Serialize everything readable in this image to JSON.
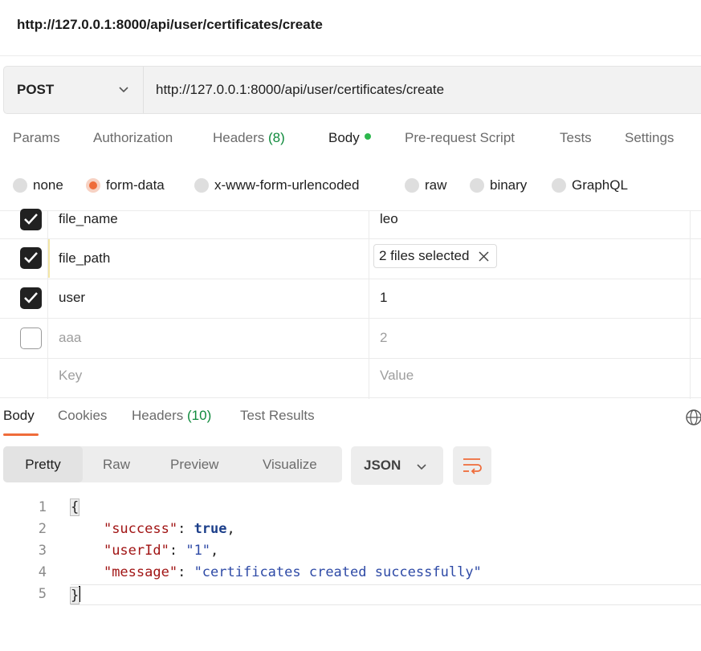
{
  "window": {
    "title": "http://127.0.0.1:8000/api/user/certificates/create"
  },
  "request": {
    "method": "POST",
    "url": "http://127.0.0.1:8000/api/user/certificates/create"
  },
  "request_tabs": [
    {
      "label": "Params"
    },
    {
      "label": "Authorization"
    },
    {
      "label": "Headers",
      "count": "(8)"
    },
    {
      "label": "Body",
      "active": true
    },
    {
      "label": "Pre-request Script"
    },
    {
      "label": "Tests"
    },
    {
      "label": "Settings"
    }
  ],
  "body_types": [
    "none",
    "form-data",
    "x-www-form-urlencoded",
    "raw",
    "binary",
    "GraphQL"
  ],
  "body_type_selected": "form-data",
  "form_data": [
    {
      "key": "file_name",
      "value": "leo",
      "checked": true
    },
    {
      "key": "file_path",
      "value": "2 files selected",
      "checked": true,
      "type": "file"
    },
    {
      "key": "user",
      "value": "1",
      "checked": true
    },
    {
      "key": "aaa",
      "value": "2",
      "checked": false
    }
  ],
  "form_placeholder": {
    "key": "Key",
    "value": "Value"
  },
  "response_tabs": [
    {
      "label": "Body",
      "active": true
    },
    {
      "label": "Cookies"
    },
    {
      "label": "Headers",
      "count": "(10)"
    },
    {
      "label": "Test Results"
    }
  ],
  "view_modes": [
    "Pretty",
    "Raw",
    "Preview",
    "Visualize"
  ],
  "view_mode_selected": "Pretty",
  "format": "JSON",
  "response_lines": [
    {
      "n": "1",
      "open": "{"
    },
    {
      "n": "2",
      "key": "\"success\"",
      "value": "true",
      "kind": "bool",
      "comma": ","
    },
    {
      "n": "3",
      "key": "\"userId\"",
      "value": "\"1\"",
      "kind": "str",
      "comma": ","
    },
    {
      "n": "4",
      "key": "\"message\"",
      "value": "\"certificates created successfully\"",
      "kind": "str",
      "comma": ""
    },
    {
      "n": "5",
      "close": "}"
    }
  ],
  "colors": {
    "accent": "#ef6c3a",
    "dot": "#2db84d",
    "count": "#0f8a3c"
  },
  "icons": {
    "method_dropdown": "chevron-down-icon",
    "globe": "globe-icon",
    "wrap": "wrap-lines-icon",
    "remove_files": "close-icon"
  }
}
